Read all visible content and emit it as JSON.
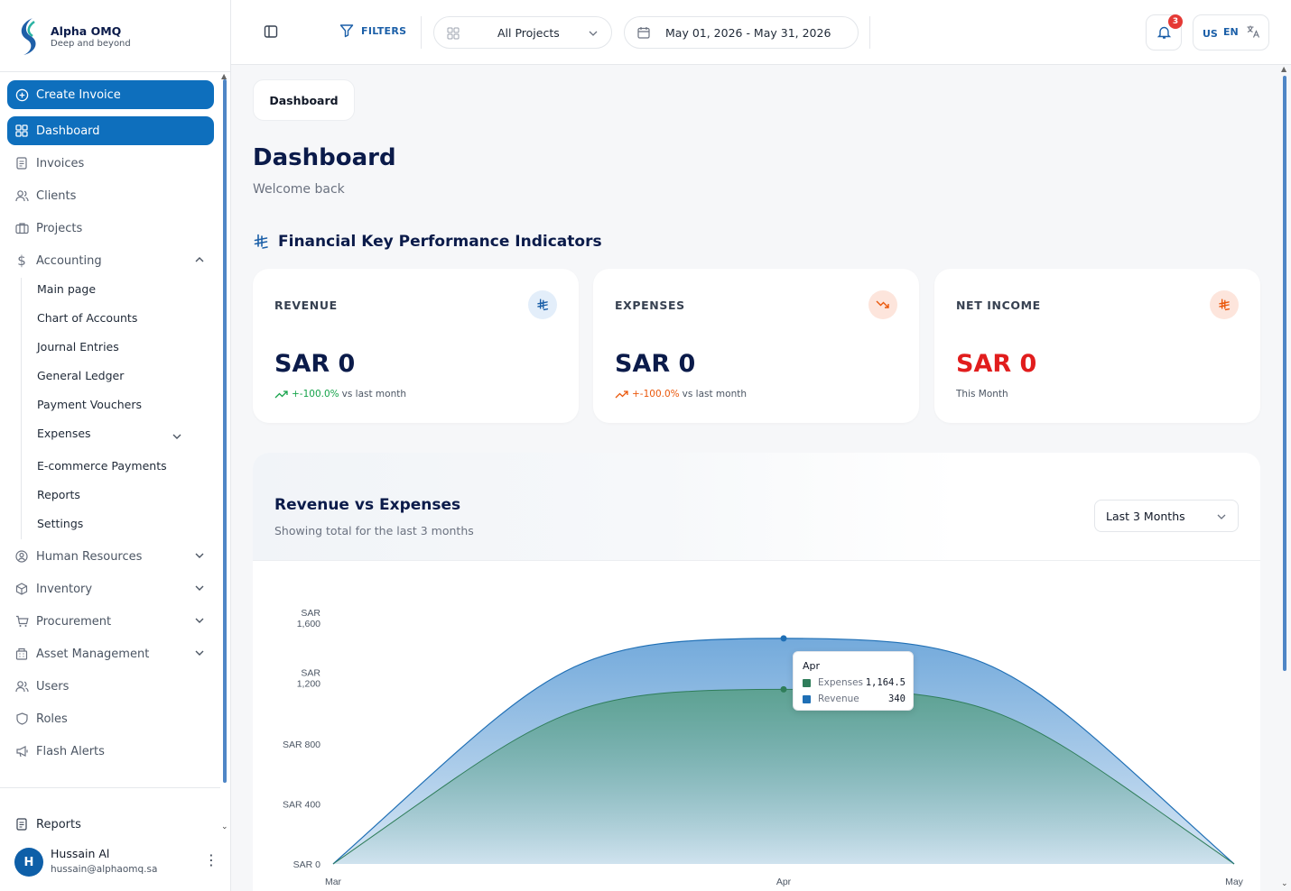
{
  "brand": {
    "name": "Alpha OMQ",
    "tagline": "Deep and beyond"
  },
  "sidebar": {
    "create_invoice": "Create Invoice",
    "dashboard": "Dashboard",
    "items": {
      "invoices": "Invoices",
      "clients": "Clients",
      "projects": "Projects",
      "accounting": "Accounting",
      "human_resources": "Human Resources",
      "inventory": "Inventory",
      "procurement": "Procurement",
      "asset_management": "Asset Management",
      "users": "Users",
      "roles": "Roles",
      "flash_alerts": "Flash Alerts",
      "reports": "Reports"
    },
    "accounting_sub": {
      "main_page": "Main page",
      "chart_of_accounts": "Chart of Accounts",
      "journal_entries": "Journal Entries",
      "general_ledger": "General Ledger",
      "payment_vouchers": "Payment Vouchers",
      "expenses": "Expenses",
      "ecommerce_payments": "E-commerce Payments",
      "reports": "Reports",
      "settings": "Settings"
    }
  },
  "user": {
    "initial": "H",
    "name": "Hussain Al",
    "email": "hussain@alphaomq.sa"
  },
  "topbar": {
    "filters": "FILTERS",
    "project_select": "All Projects",
    "date_range": "May 01, 2026 - May 31, 2026",
    "notification_count": "3",
    "lang_country": "US",
    "lang_code": "EN"
  },
  "main": {
    "breadcrumb": "Dashboard",
    "title": "Dashboard",
    "welcome": "Welcome back",
    "kpi_title": "Financial Key Performance Indicators",
    "kpis": {
      "revenue": {
        "label": "REVENUE",
        "value": "SAR 0",
        "delta": "+-100.0%",
        "suffix": "vs last month"
      },
      "expenses": {
        "label": "EXPENSES",
        "value": "SAR 0",
        "delta": "+-100.0%",
        "suffix": "vs last month"
      },
      "net_income": {
        "label": "NET INCOME",
        "value": "SAR 0",
        "note": "This Month"
      }
    }
  },
  "chart_panel": {
    "title": "Revenue vs Expenses",
    "subtitle": "Showing total for the last 3 months",
    "range": "Last 3 Months"
  },
  "tooltip": {
    "label": "Apr",
    "expenses_name": "Expenses",
    "expenses_value": "1,164.5",
    "revenue_name": "Revenue",
    "revenue_value": "340"
  },
  "colors": {
    "primary": "#0e6fbd",
    "revenue": "#1f6fb5",
    "expenses": "#2f7d5a",
    "danger": "#e11d1d",
    "success": "#16a34a",
    "warning": "#ea580c"
  },
  "chart_data": {
    "type": "area",
    "stacked": true,
    "categories": [
      "Mar",
      "Apr",
      "May"
    ],
    "series": [
      {
        "name": "Expenses",
        "values": [
          0,
          1164.5,
          0
        ]
      },
      {
        "name": "Revenue",
        "values": [
          0,
          340,
          0
        ]
      }
    ],
    "y_ticks": [
      "SAR 0",
      "SAR 400",
      "SAR 800",
      "SAR 1,200",
      "SAR 1,600"
    ],
    "ylim": [
      0,
      1600
    ],
    "grid": false,
    "legend": "none"
  }
}
